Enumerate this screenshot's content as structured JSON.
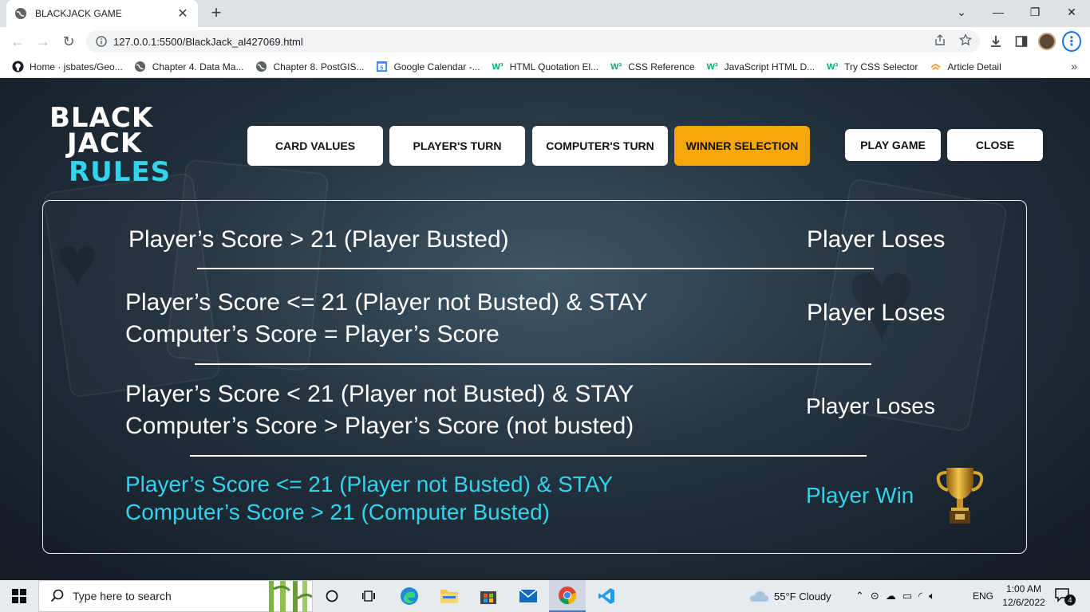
{
  "browser": {
    "tab_title": "BLACKJACK GAME",
    "url": "127.0.0.1:5500/BlackJack_al427069.html",
    "bookmarks": [
      {
        "label": "Home · jsbates/Geo...",
        "icon": "github-icon"
      },
      {
        "label": "Chapter 4. Data Ma...",
        "icon": "globe-icon"
      },
      {
        "label": "Chapter 8. PostGIS...",
        "icon": "globe-icon"
      },
      {
        "label": "Google Calendar -...",
        "icon": "calendar-icon"
      },
      {
        "label": "HTML Quotation El...",
        "icon": "w3schools-icon"
      },
      {
        "label": "CSS Reference",
        "icon": "w3schools-icon"
      },
      {
        "label": "JavaScript HTML D...",
        "icon": "w3schools-icon"
      },
      {
        "label": "Try CSS Selector",
        "icon": "w3schools-icon"
      },
      {
        "label": "Article Detail",
        "icon": "article-icon"
      }
    ]
  },
  "logo": {
    "line1": "BLACK",
    "line2": "JACK",
    "line3": "RULES"
  },
  "nav": {
    "card_values": "CARD VALUES",
    "players_turn": "PLAYER'S TURN",
    "computers_turn": "COMPUTER'S TURN",
    "winner_selection": "WINNER SELECTION",
    "active": "WINNER SELECTION",
    "active_color": "#f5a70a"
  },
  "actions": {
    "play_game": "PLAY GAME",
    "close": "CLOSE"
  },
  "rules": [
    {
      "line1": "Player’s Score > 21 (Player Busted)",
      "line2": "",
      "result": "Player Loses"
    },
    {
      "line1": "Player’s Score <= 21 (Player not Busted)  &  STAY",
      "line2": "Computer’s Score = Player’s Score",
      "result": "Player Loses"
    },
    {
      "line1": "Player’s Score < 21 (Player not Busted)  &  STAY",
      "line2": "Computer’s Score > Player’s Score (not busted)",
      "result": "Player Loses"
    },
    {
      "line1": "Player’s Score <= 21 (Player not Busted)  &  STAY",
      "line2": "Computer’s Score > 21 (Computer Busted)",
      "result": "Player Win"
    }
  ],
  "colors": {
    "accent_cyan": "#32d3ec",
    "accent_orange": "#f5a70a"
  },
  "taskbar": {
    "search_placeholder": "Type here to search",
    "weather": "55°F  Cloudy",
    "language": "ENG",
    "time": "1:00 AM",
    "date": "12/6/2022",
    "notifications": "4"
  }
}
